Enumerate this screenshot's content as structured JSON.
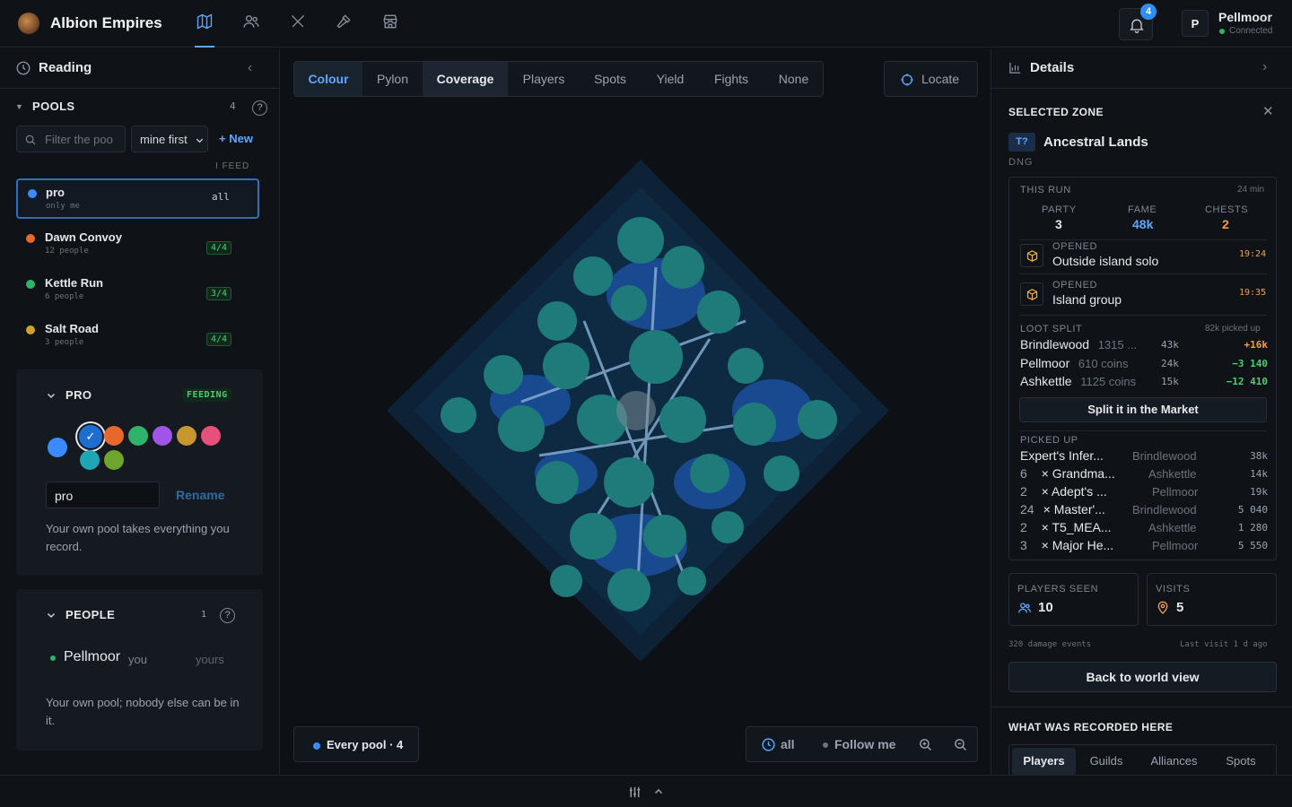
{
  "app": {
    "title": "Albion Empires"
  },
  "nav": {
    "icons": [
      "map-icon",
      "people-icon",
      "swords-icon",
      "hammer-icon",
      "store-icon"
    ]
  },
  "user": {
    "initial": "P",
    "name": "Pellmoor",
    "status": "Connected",
    "notifications": "4"
  },
  "left": {
    "title": "Reading",
    "pools": {
      "header": "POOLS",
      "count": "4",
      "filter_placeholder": "Filter the poo",
      "sort": "mine first",
      "new_label": "New",
      "feed_label": "I FEED",
      "items": [
        {
          "name": "pro",
          "sub": "only me",
          "tag": "all",
          "color": "#3b8bff"
        },
        {
          "name": "Dawn Convoy",
          "sub": "12 people",
          "tag": "4/4",
          "color": "#e8672c"
        },
        {
          "name": "Kettle Run",
          "sub": "6 people",
          "tag": "3/4",
          "color": "#2fb36a"
        },
        {
          "name": "Salt Road",
          "sub": "3 people",
          "tag": "4/4",
          "color": "#d3a12a"
        }
      ]
    },
    "pro": {
      "title": "PRO",
      "badge": "FEEDING",
      "name_value": "pro",
      "rename": "Rename",
      "description": "Your own pool takes everything you record.",
      "colors": [
        "#3b8bff",
        "#1c6fd1",
        "#e8672c",
        "#2fb36a",
        "#a155e8",
        "#c7962e",
        "#e84f7a",
        "#1ea6b5",
        "#6fa52a"
      ]
    },
    "people": {
      "title": "PEOPLE",
      "count": "1",
      "member": "Pellmoor",
      "you": "you",
      "yours": "yours",
      "description": "Your own pool; nobody else can be in it."
    }
  },
  "map": {
    "layers": [
      "Colour",
      "Pylon",
      "Coverage",
      "Players",
      "Spots",
      "Yield",
      "Fights",
      "None"
    ],
    "selected_layer": "Colour",
    "active_layer": "Coverage",
    "locate": "Locate",
    "pool_filter": "Every pool · 4",
    "time": "all",
    "follow": "Follow me"
  },
  "details": {
    "title": "Details",
    "selected_zone_label": "SELECTED ZONE",
    "tier": "T?",
    "zone_name": "Ancestral Lands",
    "zone_type": "DNG",
    "run": {
      "label": "THIS RUN",
      "duration": "24 min",
      "party_label": "PARTY",
      "party": "3",
      "fame_label": "FAME",
      "fame": "48k",
      "chests_label": "CHESTS",
      "chests": "2",
      "opened": [
        {
          "label": "OPENED",
          "name": "Outside island solo",
          "time": "19:24"
        },
        {
          "label": "OPENED",
          "name": "Island group",
          "time": "19:35"
        }
      ]
    },
    "loot": {
      "label": "LOOT SPLIT",
      "picked_total": "82k picked up",
      "rows": [
        {
          "name": "Brindlewood",
          "coins": "1315 ...",
          "value": "43k",
          "delta": "+16k",
          "delta_color": "#f0a23a"
        },
        {
          "name": "Pellmoor",
          "coins": "610 coins",
          "value": "24k",
          "delta": "−3 140",
          "delta_color": "#4ccb72"
        },
        {
          "name": "Ashkettle",
          "coins": "1125 coins",
          "value": "15k",
          "delta": "−12 410",
          "delta_color": "#4ccb72"
        }
      ],
      "split_button": "Split it in the Market"
    },
    "picked": {
      "label": "PICKED UP",
      "rows": [
        {
          "qty": "",
          "item": "Expert's Infer...",
          "who": "Brindlewood",
          "value": "38k"
        },
        {
          "qty": "6",
          "item": "× Grandma...",
          "who": "Ashkettle",
          "value": "14k"
        },
        {
          "qty": "2",
          "item": "× Adept's ...",
          "who": "Pellmoor",
          "value": "19k"
        },
        {
          "qty": "24",
          "item": "× Master'...",
          "who": "Brindlewood",
          "value": "5 040"
        },
        {
          "qty": "2",
          "item": "× T5_MEA...",
          "who": "Ashkettle",
          "value": "1 280"
        },
        {
          "qty": "3",
          "item": "× Major He...",
          "who": "Pellmoor",
          "value": "5 550"
        }
      ]
    },
    "players_seen_label": "PLAYERS SEEN",
    "players_seen": "10",
    "visits_label": "VISITS",
    "visits": "5",
    "damage_events": "320 damage events",
    "last_visit": "Last visit 1 d ago",
    "back_button": "Back to world view",
    "recorded_label": "WHAT WAS RECORDED HERE",
    "recorded_tabs": [
      "Players",
      "Guilds",
      "Alliances",
      "Spots"
    ]
  }
}
